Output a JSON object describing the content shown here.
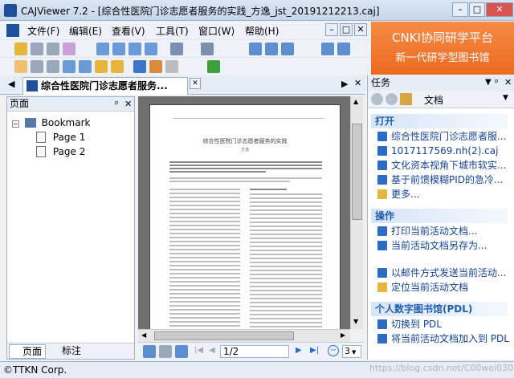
{
  "window": {
    "title": "CAJViewer 7.2 - [综合性医院门诊志愿者服务的实践_方逸_jst_20191212213.caj]",
    "minimize": "–",
    "maximize": "□",
    "close": "✕"
  },
  "menu": [
    "文件(F)",
    "编辑(E)",
    "查看(V)",
    "工具(T)",
    "窗口(W)",
    "帮助(H)"
  ],
  "banner": {
    "line1": "CNKI协同研学平台",
    "line2": "新一代研学型图书馆"
  },
  "tab": {
    "title": "综合性医院门诊志愿者服务..."
  },
  "left_panel": {
    "header": "页面",
    "bookmark": "Bookmark",
    "pages": [
      "Page 1",
      "Page 2"
    ],
    "tab_pages": "页面",
    "tab_annotations": "标注"
  },
  "document": {
    "title": "综合性医院门诊志愿者服务的实践",
    "author": "方逸"
  },
  "navigation": {
    "page_indicator": "1/2",
    "zoom": "3"
  },
  "task_pane": {
    "header": "任务",
    "toolbar_label": "文档",
    "sections": [
      {
        "title": "打开",
        "items": [
          "综合性医院门诊志愿者服...",
          "1017117569.nh(2).caj",
          "文化资本视角下城市软实...",
          "基于前馈模糊PID的急冷...",
          "更多..."
        ]
      },
      {
        "title": "操作",
        "items": [
          "打印当前活动文档...",
          "当前活动文档另存为...",
          "以邮件方式发送当前活动...",
          "定位当前活动文档"
        ]
      },
      {
        "title": "个人数字图书馆(PDL)",
        "items": [
          "切换到 PDL",
          "将当前活动文档加入到 PDL"
        ]
      }
    ]
  },
  "status": {
    "text": "©TTKN Corp.",
    "watermark": "https://blog.csdn.net/C00wei0305"
  }
}
